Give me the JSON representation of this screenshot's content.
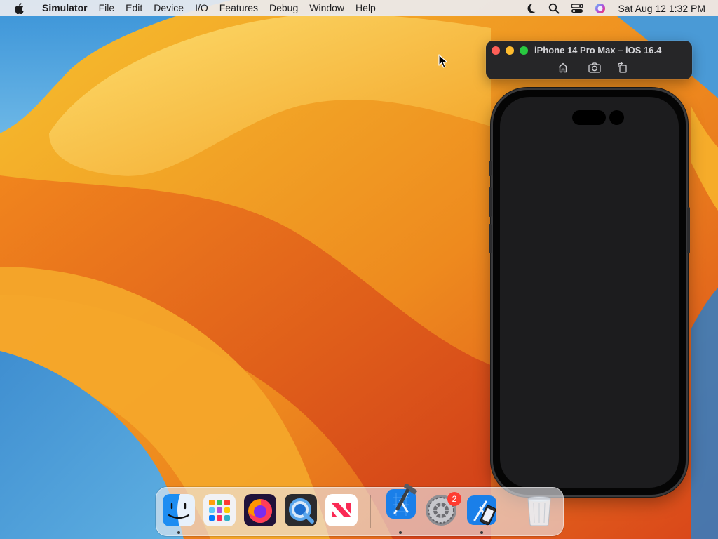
{
  "menubar": {
    "app_name": "Simulator",
    "items": [
      "File",
      "Edit",
      "Device",
      "I/O",
      "Features",
      "Debug",
      "Window",
      "Help"
    ],
    "clock": "Sat Aug 12  1:32 PM",
    "status_icons": [
      "focus-moon-icon",
      "spotlight-search-icon",
      "control-center-icon",
      "siri-icon"
    ]
  },
  "simulator": {
    "title": "iPhone 14 Pro Max – iOS 16.4",
    "toolbar_buttons": [
      "home-icon",
      "screenshot-icon",
      "rotate-icon"
    ]
  },
  "dock": {
    "apps": [
      "Finder",
      "Launchpad",
      "Firefox",
      "QuickTime Player",
      "News",
      "Xcode",
      "System Settings",
      "Simulator",
      "Trash"
    ],
    "badge_system_settings": "2"
  },
  "colors": {
    "close": "#fe5f57",
    "minimize": "#febc2e",
    "maximize": "#28c840",
    "badge": "#ff3b30"
  }
}
